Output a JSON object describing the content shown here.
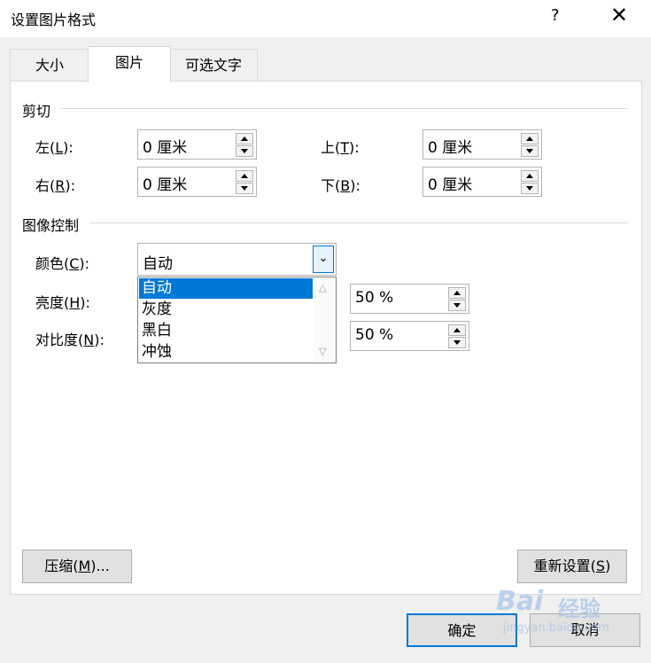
{
  "window": {
    "title": "设置图片格式",
    "help": "?",
    "close": "✕"
  },
  "tabs": [
    "大小",
    "图片",
    "可选文字"
  ],
  "crop": {
    "heading": "剪切",
    "left_label": "左(",
    "left_key": "L",
    "left_tail": "):",
    "left_value": "0 厘米",
    "right_label": "右(",
    "right_key": "R",
    "right_tail": "):",
    "right_value": "0 厘米",
    "top_label": "上(",
    "top_key": "T",
    "top_tail": "):",
    "top_value": "0 厘米",
    "bottom_label": "下(",
    "bottom_key": "B",
    "bottom_tail": "):",
    "bottom_value": "0 厘米"
  },
  "image_control": {
    "heading": "图像控制",
    "color_label": "颜色(",
    "color_key": "C",
    "color_tail": "):",
    "color_value": "自动",
    "color_options": [
      "自动",
      "灰度",
      "黑白",
      "冲蚀"
    ],
    "brightness_label": "亮度(",
    "brightness_key": "H",
    "brightness_tail": "):",
    "brightness_value": "50 %",
    "contrast_label": "对比度(",
    "contrast_key": "N",
    "contrast_tail": "):",
    "contrast_value": "50 %"
  },
  "buttons": {
    "compress_pre": "压缩(",
    "compress_key": "M",
    "compress_post": ")...",
    "reset_pre": "重新设置(",
    "reset_key": "S",
    "reset_post": ")",
    "ok": "确定",
    "cancel": "取消"
  },
  "watermark": {
    "brand1": "Bai",
    "brand2": "经验",
    "url": "jingyan.baidu.com"
  },
  "icons": {
    "combo_chevron": "chevron-down-icon",
    "spin_up": "triangle-up-icon",
    "spin_down": "triangle-down-icon"
  }
}
